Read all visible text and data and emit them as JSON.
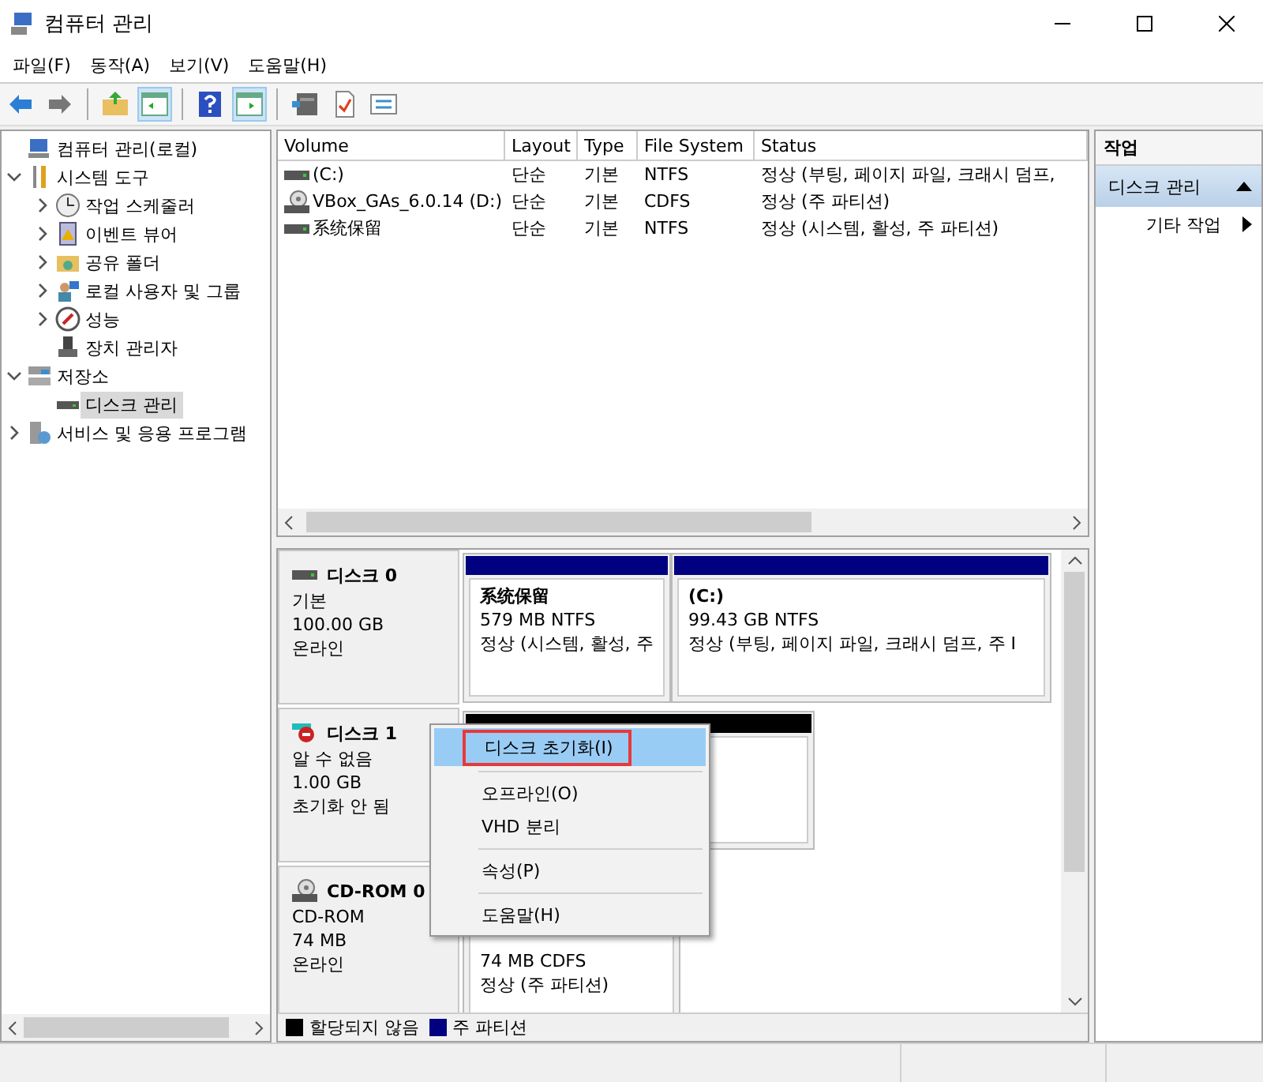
{
  "window": {
    "title": "컴퓨터 관리"
  },
  "menu": [
    "파일(F)",
    "동작(A)",
    "보기(V)",
    "도움말(H)"
  ],
  "toolbar": [
    {
      "pressed": false
    },
    {
      "pressed": false
    },
    {
      "pressed": false
    },
    {
      "pressed": true
    },
    {
      "pressed": false
    },
    {
      "pressed": true
    },
    {
      "pressed": false
    },
    {
      "pressed": false
    },
    {
      "pressed": false
    }
  ],
  "tree": {
    "label": "컴퓨터 관리(로컬)",
    "children": [
      {
        "label": "시스템 도구",
        "kind": "branch",
        "expanded": true,
        "selected": false,
        "children": [
          {
            "label": "작업 스케줄러",
            "kind": "branch",
            "expanded": false,
            "selected": false
          },
          {
            "label": "이벤트 뷰어",
            "kind": "branch",
            "expanded": false,
            "selected": false
          },
          {
            "label": "공유 폴더",
            "kind": "branch",
            "expanded": false,
            "selected": false
          },
          {
            "label": "로컬 사용자 및 그룹",
            "kind": "branch",
            "expanded": false,
            "selected": false
          },
          {
            "label": "성능",
            "kind": "branch",
            "expanded": false,
            "selected": false
          },
          {
            "label": "장치 관리자",
            "kind": "leaf",
            "selected": false
          }
        ]
      },
      {
        "label": "저장소",
        "kind": "branch",
        "expanded": true,
        "selected": false,
        "children": [
          {
            "label": "디스크 관리",
            "kind": "leaf",
            "selected": true
          }
        ]
      },
      {
        "label": "서비스 및 응용 프로그램",
        "kind": "branch",
        "expanded": false,
        "selected": false
      }
    ]
  },
  "volume_table": {
    "columns": [
      "Volume",
      "Layout",
      "Type",
      "File System",
      "Status"
    ],
    "rows": [
      {
        "cells": [
          " (C:)",
          "단순",
          "기본",
          "NTFS",
          "정상 (부팅, 페이지 파일, 크래시 덤프,"
        ]
      },
      {
        "cells": [
          "VBox_GAs_6.0.14 (D:)",
          "단순",
          "기본",
          "CDFS",
          "정상 (주 파티션)"
        ]
      },
      {
        "cells": [
          "系统保留",
          "단순",
          "기본",
          "NTFS",
          "정상 (시스템, 활성, 주 파티션)"
        ]
      }
    ]
  },
  "disks": [
    {
      "name": "디스크 0",
      "lines": [
        "기본",
        "100.00 GB",
        "온라인"
      ],
      "partitions": [
        {
          "kind": "primary",
          "name": "系统保留",
          "size": "579 MB NTFS",
          "status": "정상 (시스템, 활성, 주"
        },
        {
          "kind": "primary",
          "name": " (C:)",
          "size": "99.43 GB NTFS",
          "status": "정상 (부팅, 페이지 파일, 크래시 덤프, 주 I"
        }
      ]
    },
    {
      "name": "디스크 1",
      "lines": [
        "알 수 없음",
        "1.00 GB",
        "초기화 안 됨"
      ],
      "partitions": [
        {
          "kind": "unallocated"
        }
      ]
    },
    {
      "name": "CD-ROM 0",
      "lines": [
        "CD-ROM",
        "74 MB",
        "온라인"
      ],
      "partitions": [
        {
          "size": "74 MB CDFS",
          "status": "정상 (주 파티션)"
        }
      ]
    }
  ],
  "context_menu": [
    {
      "kind": "item",
      "label": "디스크 초기화(I)",
      "selected": true
    },
    {
      "kind": "separator"
    },
    {
      "kind": "item",
      "label": "오프라인(O)",
      "selected": false
    },
    {
      "kind": "item",
      "label": "VHD 분리",
      "selected": false
    },
    {
      "kind": "separator"
    },
    {
      "kind": "item",
      "label": "속성(P)",
      "selected": false
    },
    {
      "kind": "separator"
    },
    {
      "kind": "item",
      "label": "도움말(H)",
      "selected": false
    }
  ],
  "legend": [
    {
      "label": "할당되지 않음",
      "color": "#000000"
    },
    {
      "label": "주 파티션",
      "color": "#000080"
    }
  ],
  "actions": {
    "title": "작업",
    "sections": [
      {
        "label": "디스크 관리",
        "expanded": true,
        "items": [
          "기타 작업"
        ]
      }
    ]
  }
}
